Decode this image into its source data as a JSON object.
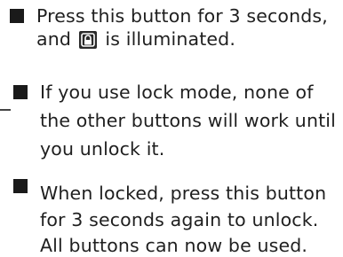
{
  "instructions": [
    {
      "lines": [
        "Press this button for 3 seconds,",
        "and",
        "is illuminated."
      ],
      "inline_icon": "lock-icon"
    },
    {
      "lines": [
        "If you use lock mode, none of",
        "the other buttons will work until",
        "you unlock it."
      ]
    },
    {
      "lines": [
        "When locked, press this button",
        "for 3 seconds again to unlock.",
        "All buttons can now be used."
      ]
    }
  ]
}
